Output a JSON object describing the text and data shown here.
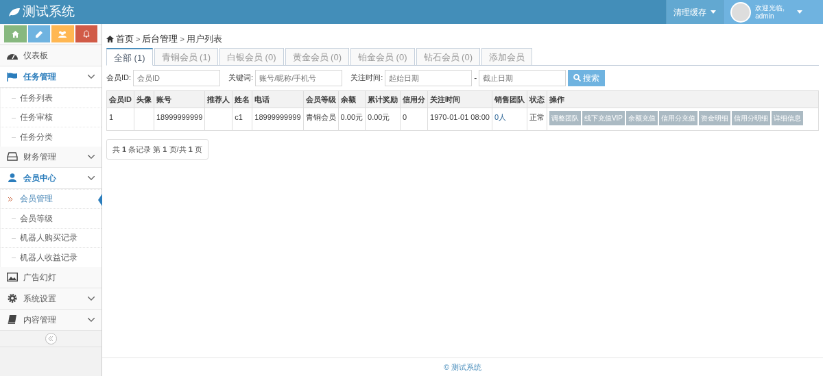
{
  "header": {
    "brand": "测试系统",
    "cache_menu": "清理缓存",
    "welcome": "欢迎光临,",
    "user": "admin"
  },
  "sidebar": {
    "shortcuts": [
      {
        "color": "#87b87f"
      },
      {
        "color": "#6fb3e0"
      },
      {
        "color": "#ffb752"
      },
      {
        "color": "#d15b47"
      }
    ],
    "items": [
      {
        "label": "仪表板",
        "expandable": false,
        "expanded": false
      },
      {
        "label": "任务管理",
        "expandable": true,
        "expanded": true,
        "children": [
          {
            "label": "任务列表",
            "selected": false
          },
          {
            "label": "任务审核",
            "selected": false
          },
          {
            "label": "任务分类",
            "selected": false
          }
        ]
      },
      {
        "label": "财务管理",
        "expandable": true,
        "expanded": false
      },
      {
        "label": "会员中心",
        "expandable": true,
        "expanded": true,
        "children": [
          {
            "label": "会员管理",
            "selected": true
          },
          {
            "label": "会员等级",
            "selected": false
          },
          {
            "label": "机器人购买记录",
            "selected": false
          },
          {
            "label": "机器人收益记录",
            "selected": false
          }
        ]
      },
      {
        "label": "广告幻灯",
        "expandable": false,
        "expanded": false
      },
      {
        "label": "系统设置",
        "expandable": true,
        "expanded": false
      },
      {
        "label": "内容管理",
        "expandable": true,
        "expanded": false
      }
    ]
  },
  "breadcrumb": [
    {
      "kind": "link",
      "text": "首页"
    },
    {
      "kind": "separator",
      "text": ">"
    },
    {
      "kind": "link",
      "text": "后台管理"
    },
    {
      "kind": "separator",
      "text": ">"
    },
    {
      "kind": "current",
      "text": "用户列表"
    }
  ],
  "tabs": [
    {
      "label": "全部 (1)",
      "selected": true
    },
    {
      "label": "青铜会员 (1)",
      "selected": false
    },
    {
      "label": "白银会员 (0)",
      "selected": false
    },
    {
      "label": "黄金会员 (0)",
      "selected": false
    },
    {
      "label": "铂金会员 (0)",
      "selected": false
    },
    {
      "label": "钻石会员 (0)",
      "selected": false
    },
    {
      "label": "添加会员",
      "selected": false
    }
  ],
  "filters": {
    "member_id": {
      "label": "会员ID:",
      "placeholder": "会员ID"
    },
    "keyword": {
      "label": "关键词:",
      "placeholder": "账号/昵称/手机号"
    },
    "follow_time": {
      "label": "关注时间:",
      "start_placeholder": "起始日期",
      "separator": "-",
      "end_placeholder": "截止日期"
    },
    "search_button": "搜索"
  },
  "table": {
    "columns": [
      "会员ID",
      "头像",
      "账号",
      "推荐人",
      "姓名",
      "电话",
      "会员等级",
      "余额",
      "累计奖励",
      "信用分",
      "关注时间",
      "销售团队",
      "状态",
      "操作"
    ],
    "rows": [
      {
        "cells": [
          "1",
          "",
          "18999999999",
          "",
          "c1",
          "18999999999",
          "青铜会员",
          "0.00元",
          "0.00元",
          "0",
          "1970-01-01 08:00",
          "0人",
          "正常"
        ],
        "actions": [
          "调整团队",
          "线下充值VIP",
          "余额充值",
          "信用分充值",
          "资金明细",
          "信用分明细",
          "详细信息"
        ]
      }
    ]
  },
  "pagination": "共 **1** 条记录 第 **1** 页/共 **1** 页",
  "footer": "© 测试系统"
}
